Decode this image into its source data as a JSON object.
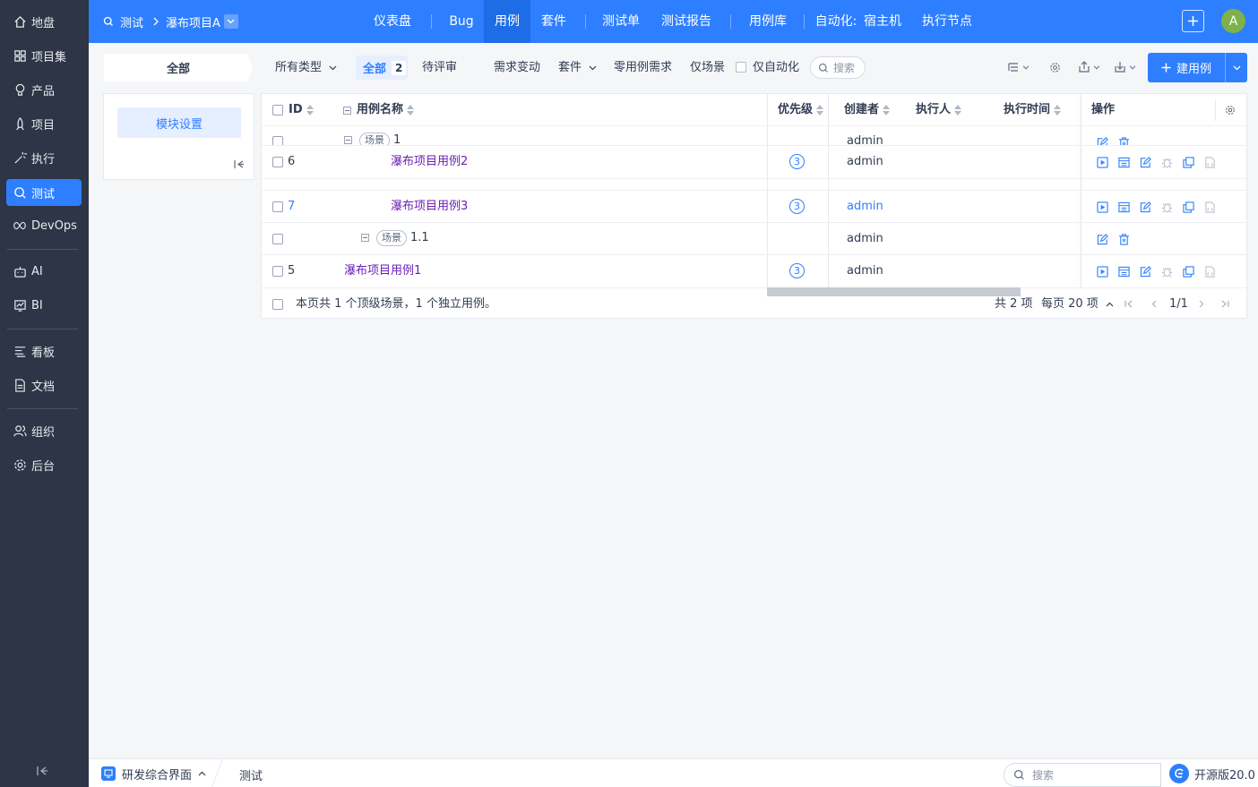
{
  "sidebar": {
    "items": [
      {
        "label": "地盘",
        "icon": "home-icon"
      },
      {
        "label": "项目集",
        "icon": "grid-icon"
      },
      {
        "label": "产品",
        "icon": "bulb-icon"
      },
      {
        "label": "项目",
        "icon": "rocket-icon"
      },
      {
        "label": "执行",
        "icon": "wand-icon"
      },
      {
        "label": "测试",
        "icon": "search-icon"
      },
      {
        "label": "DevOps",
        "icon": "infinity-icon"
      },
      {
        "label": "AI",
        "icon": "robot-icon"
      },
      {
        "label": "BI",
        "icon": "chart-icon"
      },
      {
        "label": "看板",
        "icon": "kanban-icon"
      },
      {
        "label": "文档",
        "icon": "document-icon"
      },
      {
        "label": "组织",
        "icon": "people-icon"
      },
      {
        "label": "后台",
        "icon": "gear-icon"
      }
    ],
    "active": "测试"
  },
  "topbar": {
    "breadcrumb_module": "测试",
    "breadcrumb_project": "瀑布项目A",
    "tabs": [
      "仪表盘",
      "Bug",
      "用例",
      "套件",
      "测试单",
      "测试报告",
      "用例库",
      "自动化:",
      "宿主机",
      "执行节点"
    ],
    "active_tab": "用例",
    "avatar_initial": "A"
  },
  "toolbar": {
    "module_all": "全部",
    "type_filter": "所有类型",
    "all_label": "全部",
    "all_count": "2",
    "review": "待评审",
    "need_change": "需求变动",
    "suite": "套件",
    "zero_case": "零用例需求",
    "scene_only": "仅场景",
    "auto_only": "仅自动化",
    "search_placeholder": "搜索",
    "create_label": "建用例"
  },
  "side_panel": {
    "module_settings": "模块设置"
  },
  "table": {
    "headers": {
      "id": "ID",
      "name": "用例名称",
      "priority": "优先级",
      "creator": "创建者",
      "executor": "执行人",
      "exec_time": "执行时间",
      "actions": "操作"
    },
    "rows": [
      {
        "id": "",
        "scene_tag": "场景",
        "name": "1",
        "priority": "",
        "creator": "admin",
        "kind": "scene-partial"
      },
      {
        "id": "6",
        "name": "瀑布项目用例2",
        "priority": "3",
        "creator": "admin",
        "kind": "case"
      },
      {
        "id": "7",
        "name": "瀑布项目用例3",
        "priority": "3",
        "creator": "admin",
        "kind": "case"
      },
      {
        "id": "",
        "scene_tag": "场景",
        "name": "1.1",
        "priority": "",
        "creator": "admin",
        "kind": "scene"
      },
      {
        "id": "5",
        "name": "瀑布项目用例1",
        "priority": "3",
        "creator": "admin",
        "kind": "case"
      }
    ],
    "footer_summary": "本页共 1 个顶级场景，1 个独立用例。",
    "total": "共 2 项",
    "per_page": "每页 20 项",
    "page": "1/1"
  },
  "bottombar": {
    "app_name": "研发综合界面",
    "current_tab": "测试",
    "search_placeholder": "搜索",
    "version": "开源版20.0"
  },
  "colors": {
    "primary": "#2e7fff",
    "sidebar_bg": "#2e3546",
    "case_link": "#6a1fb4"
  }
}
